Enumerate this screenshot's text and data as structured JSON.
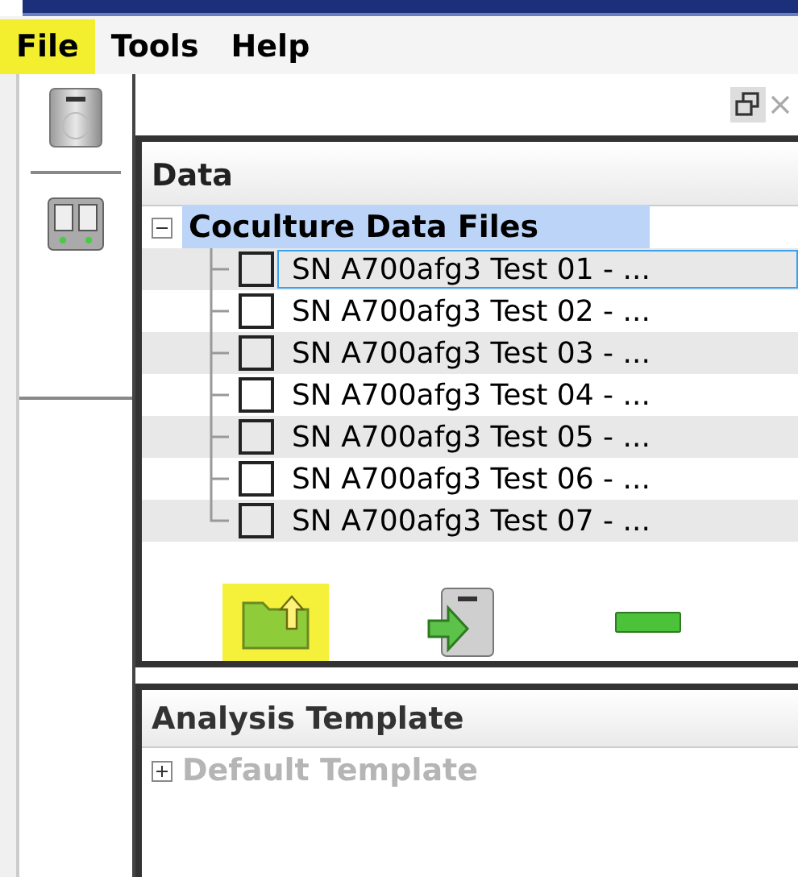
{
  "menu": [
    {
      "label": "File",
      "selected": true
    },
    {
      "label": "Tools",
      "selected": false
    },
    {
      "label": "Help",
      "selected": false
    }
  ],
  "data_panel": {
    "title": "Data",
    "tree": {
      "label": "Coculture Data Files",
      "expanded": true,
      "selected": true,
      "children": [
        {
          "label": "SN A700afg3 Test 01 - ...",
          "checked": false,
          "focused": true
        },
        {
          "label": "SN A700afg3 Test 02 - ...",
          "checked": false,
          "focused": false
        },
        {
          "label": "SN A700afg3 Test 03 - ...",
          "checked": false,
          "focused": false
        },
        {
          "label": "SN A700afg3 Test 04 - ...",
          "checked": false,
          "focused": false
        },
        {
          "label": "SN A700afg3 Test 05 - ...",
          "checked": false,
          "focused": false
        },
        {
          "label": "SN A700afg3 Test 06 - ...",
          "checked": false,
          "focused": false
        },
        {
          "label": "SN A700afg3 Test 07 - ...",
          "checked": false,
          "focused": false
        }
      ]
    }
  },
  "actions": [
    {
      "kind": "open-folder",
      "highlighted": true
    },
    {
      "kind": "import",
      "highlighted": false
    },
    {
      "kind": "remove",
      "highlighted": false
    }
  ],
  "analysis_panel": {
    "title": "Analysis Template",
    "tree": {
      "label": "Default Template",
      "expanded": false,
      "disabled": true
    }
  }
}
